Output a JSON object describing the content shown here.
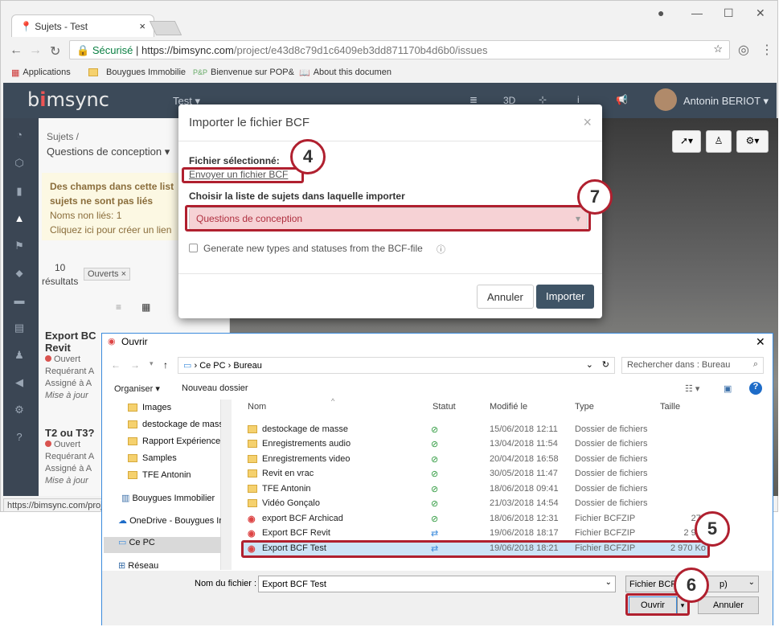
{
  "browser": {
    "tab_title": "Sujets - Test",
    "secure_label": "Sécurisé",
    "url_host": "https://bimsync.com",
    "url_path": "/project/e43d8c79d1c6409eb3dd871170b4d6b0/issues",
    "bookmarks": [
      "Applications",
      "Bouygues Immobilie",
      "Bienvenue sur POP&",
      "About this documen"
    ],
    "status_url": "https://bimsync.com/proj"
  },
  "app": {
    "logo_prefix": "b",
    "logo_dot": "i",
    "logo_rest": "msync",
    "project": "Test ▾",
    "nav_3d": "3D",
    "user": "Antonin BERIOT ▾"
  },
  "panel": {
    "breadcrumb": "Sujets /",
    "list": "Questions de conception ▾",
    "warn_line1": "Des champs dans cette list",
    "warn_line2": "sujets ne sont pas liés",
    "warn_line3": "Noms non liés: 1",
    "warn_line4": "Cliquez ici pour créer un lien",
    "count": "10",
    "count_label": "résultats",
    "filter": "Ouverts ×",
    "items": [
      {
        "title": "Export BC",
        "title2": "Revit",
        "status": "Ouvert",
        "l1": "Requérant A",
        "l2": "Assigné à A",
        "l3": "Mise à jour"
      },
      {
        "title": "T2 ou T3?",
        "status": "Ouvert",
        "l1": "Requérant A",
        "l2": "Assigné à A",
        "l3": "Mise à jour"
      }
    ]
  },
  "modal": {
    "title": "Importer le fichier BCF",
    "close": "×",
    "file_label": "Fichier sélectionné:",
    "file_link": "Envoyer un fichier BCF",
    "list_label": "Choisir la liste de sujets dans laquelle importer",
    "list_value": "Questions de conception",
    "checkbox_label": "Generate new types and statuses from the BCF-file",
    "cancel": "Annuler",
    "import": "Importer"
  },
  "annotations": {
    "n4": "4",
    "n5": "5",
    "n6": "6",
    "n7": "7"
  },
  "dialog": {
    "title": "Ouvrir",
    "crumb1": "Ce PC",
    "crumb2": "Bureau",
    "search": "Rechercher dans : Bureau",
    "organize": "Organiser ▾",
    "new_folder": "Nouveau dossier",
    "nav": [
      "Images",
      "destockage de masse",
      "Rapport Expérience Cl",
      "Samples",
      "TFE Antonin",
      "Bouygues Immobilier",
      "OneDrive - Bouygues Ir",
      "Ce PC",
      "Réseau"
    ],
    "headers": [
      "Nom",
      "Statut",
      "Modifié le",
      "Type",
      "Taille"
    ],
    "files": [
      {
        "name": "destockage de masse",
        "date": "15/06/2018 12:11",
        "type": "Dossier de fichiers",
        "size": ""
      },
      {
        "name": "Enregistrements audio",
        "date": "13/04/2018 11:54",
        "type": "Dossier de fichiers",
        "size": ""
      },
      {
        "name": "Enregistrements video",
        "date": "20/04/2018 16:58",
        "type": "Dossier de fichiers",
        "size": ""
      },
      {
        "name": "Revit en vrac",
        "date": "30/05/2018 11:47",
        "type": "Dossier de fichiers",
        "size": ""
      },
      {
        "name": "TFE Antonin",
        "date": "18/06/2018 09:41",
        "type": "Dossier de fichiers",
        "size": ""
      },
      {
        "name": "Vidéo Gonçalo",
        "date": "21/03/2018 14:54",
        "type": "Dossier de fichiers",
        "size": ""
      },
      {
        "name": "export BCF Archicad",
        "date": "18/06/2018 12:31",
        "type": "Fichier BCFZIP",
        "size": "277"
      },
      {
        "name": "Export BCF Revit",
        "date": "19/06/2018 18:17",
        "type": "Fichier BCFZIP",
        "size": "2 970"
      },
      {
        "name": "Export BCF Test",
        "date": "19/06/2018 18:21",
        "type": "Fichier BCFZIP",
        "size": "2 970 Ko"
      }
    ],
    "filename_label": "Nom du fichier :",
    "filename": "Export BCF Test",
    "filetype": "Fichier BCFZ",
    "filetype_end": "p)",
    "open": "Ouvrir",
    "cancel": "Annuler"
  }
}
